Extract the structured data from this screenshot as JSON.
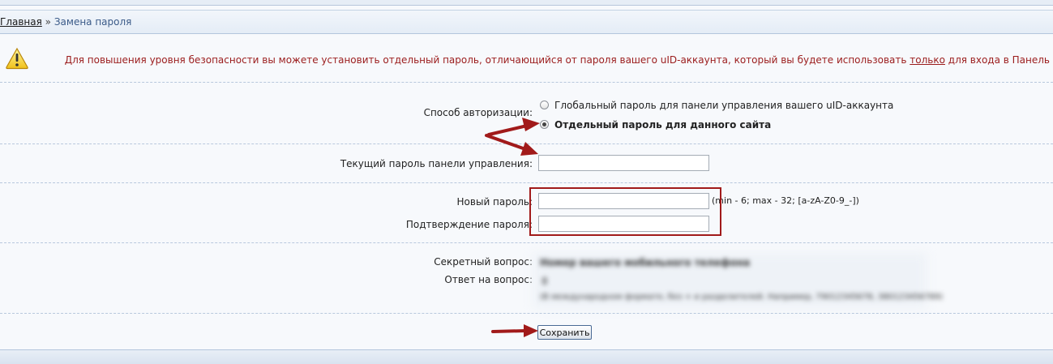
{
  "breadcrumb": {
    "home": "Главная",
    "separator": "»",
    "current": "Замена пароля"
  },
  "notice": {
    "icon": "warning-icon",
    "text_before": "Для повышения уровня безопасности вы можете установить отдельный пароль, отличающийся от пароля вашего uID-аккаунта, который вы будете использовать ",
    "emphasis": "только",
    "text_after": " для входа в Панель"
  },
  "auth": {
    "label": "Способ авторизации:",
    "options": [
      {
        "label": "Глобальный пароль для панели управления вашего uID-аккаунта",
        "selected": false
      },
      {
        "label": "Отдельный пароль для данного сайта",
        "selected": true
      }
    ]
  },
  "current_password": {
    "label": "Текущий пароль панели управления:",
    "value": ""
  },
  "new_password": {
    "label": "Новый пароль:",
    "value": "",
    "hint": "(min - 6; max - 32; [a-zA-Z0-9_-])"
  },
  "confirm_password": {
    "label": "Подтверждение пароля:",
    "value": ""
  },
  "secret_question": {
    "label": "Секретный вопрос:",
    "value": "Номер вашего мобильного телефона"
  },
  "secret_answer": {
    "label": "Ответ на вопрос:",
    "value": "8",
    "note": "(В международном формате, без + и разделителей. Например, 79012345678, 380123456789)"
  },
  "save_label": "Сохранить",
  "colors": {
    "notice_text": "#9b1c1c",
    "annotation_red": "#a11a1a",
    "dashed_line": "#b8c8dd",
    "header_bg": "#e4ecf6"
  }
}
